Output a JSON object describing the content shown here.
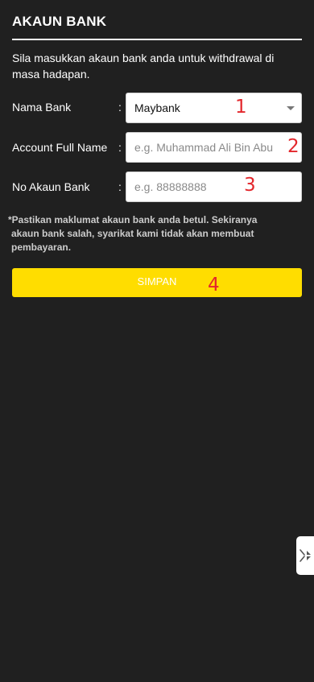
{
  "header": {
    "title": "AKAUN BANK"
  },
  "intro_text": "Sila masukkan akaun bank anda untuk withdrawal di masa hadapan.",
  "form": {
    "colon": ":",
    "bank_name": {
      "label": "Nama Bank",
      "selected": "Maybank"
    },
    "account_name": {
      "label": "Account Full Name",
      "placeholder": "e.g. Muhammad Ali Bin Abu"
    },
    "account_number": {
      "label": "No Akaun Bank",
      "placeholder": "e.g. 88888888"
    }
  },
  "markers": [
    "1",
    "2",
    "3",
    "4"
  ],
  "notice": {
    "line1": "*Pastikan maklumat akaun bank anda betul. Sekiranya",
    "line2": "akaun bank salah, syarikat kami tidak akan membuat",
    "line3": "pembayaran."
  },
  "save_button": {
    "label": "SIMPAN"
  },
  "side_tab": {
    "icon": "collapse-arrows-icon"
  },
  "colors": {
    "background": "#202020",
    "accent": "#ffdd00",
    "marker": "#e3262b"
  }
}
